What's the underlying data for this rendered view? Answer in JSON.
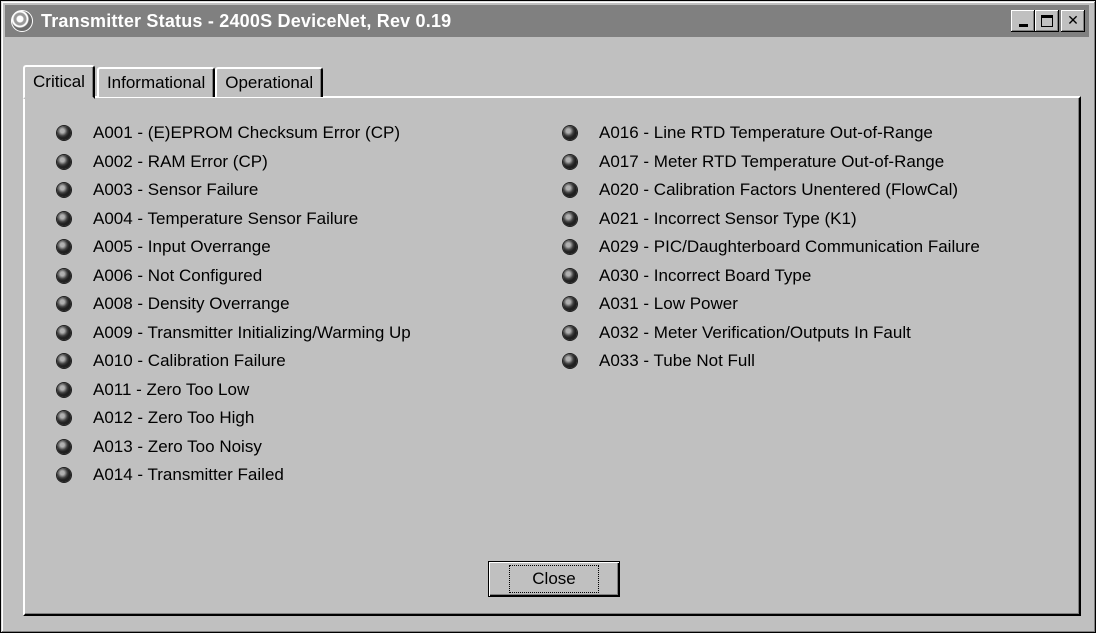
{
  "window": {
    "title": "Transmitter Status -  2400S DeviceNet, Rev 0.19"
  },
  "tabs": [
    {
      "label": "Critical",
      "active": true
    },
    {
      "label": "Informational",
      "active": false
    },
    {
      "label": "Operational",
      "active": false
    }
  ],
  "alarms_left": [
    "A001 - (E)EPROM Checksum Error (CP)",
    "A002 - RAM Error (CP)",
    "A003 - Sensor Failure",
    "A004 - Temperature Sensor Failure",
    "A005 - Input Overrange",
    "A006 - Not Configured",
    "A008 - Density Overrange",
    "A009 - Transmitter Initializing/Warming Up",
    "A010 - Calibration Failure",
    "A011 - Zero Too Low",
    "A012 - Zero Too High",
    "A013 - Zero Too Noisy",
    "A014 - Transmitter Failed"
  ],
  "alarms_right": [
    "A016 - Line RTD Temperature Out-of-Range",
    "A017 - Meter RTD Temperature Out-of-Range",
    "A020 - Calibration Factors Unentered (FlowCal)",
    "A021 - Incorrect Sensor Type (K1)",
    "A029 - PIC/Daughterboard Communication Failure",
    "A030 - Incorrect Board Type",
    "A031 - Low Power",
    "A032 - Meter Verification/Outputs In Fault",
    "A033 - Tube Not Full"
  ],
  "buttons": {
    "close_label": "Close"
  },
  "colors": {
    "face": "#c0c0c0",
    "titlebar_inactive": "#808080",
    "led_off": "#303030"
  }
}
